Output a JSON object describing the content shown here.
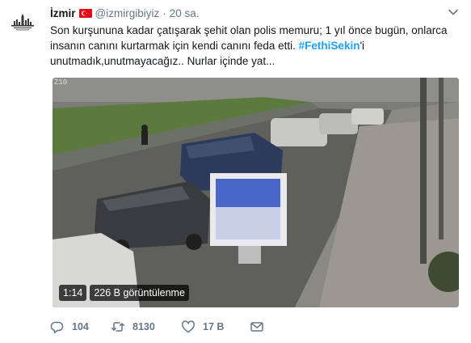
{
  "tweet": {
    "author_name": "İzmir",
    "handle": "@izmirgibiyiz",
    "separator": "·",
    "time": "20 sa.",
    "text_lines": {
      "line1": "Son kurşununa kadar çatışarak şehit olan polis memuru; 1 yıl önce bugün, onlarca",
      "line2_before": "insanın canını kurtarmak için kendi canını feda etti. ",
      "hashtag": "#FethiSekin",
      "line2_after": "'i",
      "line3": "unutmadık,unutmayacağız.. Nurlar içinde yat..."
    },
    "video": {
      "duration": "1:14",
      "views": "226 B görüntülenme",
      "overlay_stamp": "Z10"
    },
    "actions": {
      "replies": "104",
      "retweets": "8130",
      "likes": "17 B"
    }
  },
  "icons": {
    "flag": "turkey-flag-icon",
    "caret": "chevron-down-icon",
    "reply": "reply-icon",
    "retweet": "retweet-icon",
    "like": "heart-icon",
    "dm": "envelope-icon"
  },
  "colors": {
    "link": "#1da1f2",
    "secondary": "#657786",
    "text": "#14171a",
    "flag_red": "#e30a17"
  }
}
